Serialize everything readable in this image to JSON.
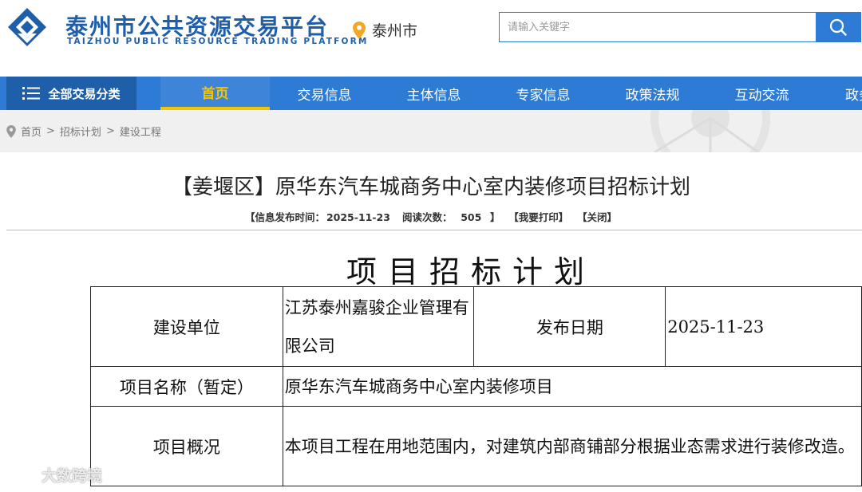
{
  "header": {
    "site_title": "泰州市公共资源交易平台",
    "site_subtitle": "TAIZHOU PUBLIC RESOURCE TRADING PLATFORM",
    "location": "泰州市",
    "search_placeholder": "请输入关键字",
    "brand_color": "#1f5fa9",
    "accent_color": "#2e7bd6"
  },
  "nav": {
    "all_categories": "全部交易分类",
    "items": [
      {
        "label": "首页",
        "active": true
      },
      {
        "label": "交易信息",
        "active": false
      },
      {
        "label": "主体信息",
        "active": false
      },
      {
        "label": "专家信息",
        "active": false
      },
      {
        "label": "政策法规",
        "active": false
      },
      {
        "label": "互动交流",
        "active": false
      },
      {
        "label": "政务",
        "active": false
      }
    ],
    "active_color": "#f5c400"
  },
  "breadcrumb": [
    "首页",
    "招标计划",
    "建设工程"
  ],
  "article": {
    "title": "【姜堰区】原华东汽车城商务中心室内装修项目招标计划",
    "publish_label": "【信息发布时间：",
    "publish_time": "2025-11-23",
    "views_label": "阅读次数：",
    "views": "505",
    "views_end": "】",
    "print_link": "【我要打印】",
    "close_link": "【关闭】"
  },
  "document": {
    "title": "项目招标计划",
    "rows": [
      {
        "label": "建设单位",
        "value": "江苏泰州嘉骏企业管理有限公司",
        "label2": "发布日期",
        "value2": "2025-11-23"
      },
      {
        "label": "项目名称（暂定）",
        "value": "原华东汽车城商务中心室内装修项目"
      },
      {
        "label": "项目概况",
        "value": "本项目工程在用地范围内，对建筑内部商铺部分根据业态需求进行装修改造。"
      }
    ]
  },
  "watermark": "大数跨境"
}
